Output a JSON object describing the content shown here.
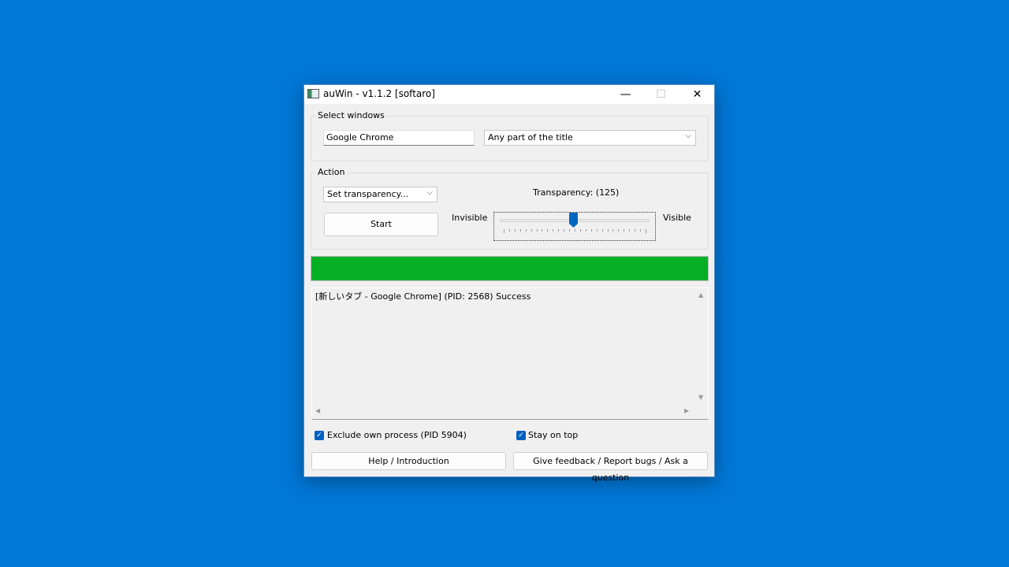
{
  "window": {
    "title": "auWin - v1.1.2 [softaro]",
    "minimize": "—",
    "maximize": "☐",
    "close": "✕"
  },
  "select_windows": {
    "legend": "Select windows",
    "title_value": "Google Chrome",
    "match_mode": "Any part of the title"
  },
  "action": {
    "legend": "Action",
    "action_value": "Set transparency...",
    "start_label": "Start",
    "transparency_label": "Transparency: (125)",
    "invisible_label": "Invisible",
    "visible_label": "Visible",
    "slider": {
      "value": 125,
      "min": 0,
      "max": 255
    }
  },
  "progress": {
    "percent": 100,
    "color": "#06b025"
  },
  "log": {
    "lines": [
      "[新しいタブ - Google Chrome] (PID: 2568) Success"
    ]
  },
  "options": {
    "exclude_label": "Exclude own process (PID 5904)",
    "exclude_checked": true,
    "stay_on_top_label": "Stay on top",
    "stay_on_top_checked": true
  },
  "footer": {
    "help_label": "Help / Introduction",
    "feedback_label": "Give feedback / Report bugs / Ask a question"
  },
  "colors": {
    "desktop": "#0078d7",
    "accent": "#0067c0"
  }
}
